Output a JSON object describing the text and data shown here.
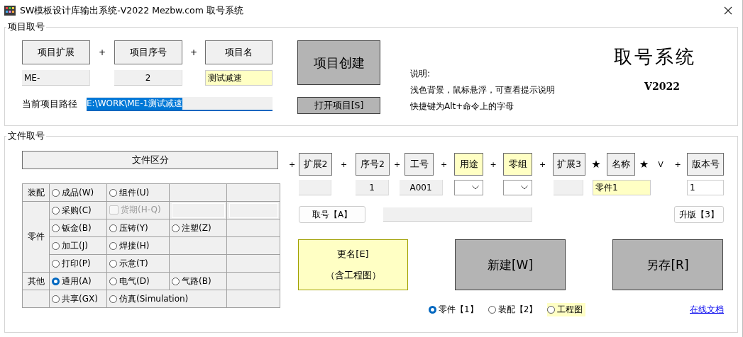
{
  "window": {
    "title": "SW模板设计库输出系统-V2022 Mezbw.com 取号系统"
  },
  "project": {
    "legend": "项目取号",
    "parts": [
      {
        "label": "项目扩展",
        "kind": "readonly",
        "value": "ME-",
        "highlight": false
      },
      {
        "label": "项目序号",
        "kind": "readonly",
        "value": "2",
        "highlight": false
      },
      {
        "label": "项目名",
        "kind": "input",
        "value": "测试减速",
        "highlight": true
      }
    ],
    "joiners": [
      "+",
      "+"
    ],
    "path_label": "当前项目路径",
    "path": {
      "value": "E:\\WORK\\ME-1测试减速",
      "text_selected": true
    },
    "create_button": "项目创建",
    "open_button": "打开项目[S]",
    "notes": [
      "说明:",
      "浅色背景，鼠标悬浮，可查看提示说明",
      "快捷键为Alt+命令上的字母"
    ],
    "app_title": "取号系统",
    "version": "V2022"
  },
  "file": {
    "legend": "文件取号",
    "category_button": "文件区分",
    "groups": [
      {
        "label": "装配",
        "rows": [
          [
            {
              "kind": "radio",
              "label": "成品(W)",
              "selected": false
            },
            {
              "kind": "radio",
              "label": "组件(U)",
              "selected": false
            },
            {
              "kind": "empty"
            },
            {
              "kind": "empty"
            }
          ]
        ]
      },
      {
        "label": "零件",
        "rows": [
          [
            {
              "kind": "radio",
              "label": "采购(C)",
              "selected": false
            },
            {
              "kind": "checkbox",
              "label": "货期(H-Q)",
              "checked": false,
              "disabled": true
            },
            {
              "kind": "field",
              "disabled": true
            },
            {
              "kind": "field",
              "disabled": true
            }
          ],
          [
            {
              "kind": "radio",
              "label": "钣金(B)",
              "selected": false
            },
            {
              "kind": "radio",
              "label": "压铸(Y)",
              "selected": false
            },
            {
              "kind": "radio",
              "label": "注塑(Z)",
              "selected": false
            },
            {
              "kind": "empty"
            }
          ],
          [
            {
              "kind": "radio",
              "label": "加工(J)",
              "selected": false
            },
            {
              "kind": "radio",
              "label": "焊接(H)",
              "selected": false
            },
            {
              "kind": "empty"
            },
            {
              "kind": "empty"
            }
          ],
          [
            {
              "kind": "radio",
              "label": "打印(P)",
              "selected": false
            },
            {
              "kind": "radio",
              "label": "示意(T)",
              "selected": false
            },
            {
              "kind": "empty"
            },
            {
              "kind": "empty"
            }
          ]
        ]
      },
      {
        "label": "其他",
        "rows": [
          [
            {
              "kind": "radio",
              "label": "通用(A)",
              "selected": true
            },
            {
              "kind": "radio",
              "label": "电气(D)",
              "selected": false
            },
            {
              "kind": "radio",
              "label": "气路(B)",
              "selected": false
            },
            {
              "kind": "empty"
            }
          ]
        ]
      },
      {
        "rows": [
          [
            {
              "kind": "radio",
              "label": "共享(GX)",
              "selected": false
            },
            {
              "kind": "radio",
              "label": "仿真(Simulation)",
              "selected": false
            },
            {
              "kind": "empty"
            }
          ]
        ]
      }
    ],
    "header": [
      {
        "kind": "sep",
        "text": "+"
      },
      {
        "kind": "button",
        "label": "扩展2",
        "highlight": false
      },
      {
        "kind": "sep",
        "text": "+"
      },
      {
        "kind": "button",
        "label": "序号2",
        "highlight": false
      },
      {
        "kind": "sep",
        "text": "+"
      },
      {
        "kind": "button",
        "label": "工号",
        "highlight": false
      },
      {
        "kind": "sep",
        "text": "+"
      },
      {
        "kind": "button",
        "label": "用途",
        "highlight": true
      },
      {
        "kind": "sep",
        "text": "+"
      },
      {
        "kind": "button",
        "label": "零组",
        "highlight": true
      },
      {
        "kind": "sep",
        "text": "+"
      },
      {
        "kind": "button",
        "label": "扩展3",
        "highlight": false
      },
      {
        "kind": "star",
        "text": "★"
      },
      {
        "kind": "button",
        "label": "名称",
        "highlight": false
      },
      {
        "kind": "star",
        "text": "★"
      },
      {
        "kind": "sep",
        "text": "V"
      },
      {
        "kind": "sep",
        "text": "+"
      },
      {
        "kind": "button",
        "label": "版本号",
        "highlight": false
      }
    ],
    "fields": [
      {
        "kind": "readonly"
      },
      {
        "kind": "readonly",
        "value": "1"
      },
      {
        "kind": "readonly",
        "value": "A001"
      },
      {
        "kind": "dropdown"
      },
      {
        "kind": "dropdown"
      },
      {
        "kind": "readonly"
      },
      {
        "kind": "input",
        "value": "零件1",
        "highlight": true
      },
      {
        "kind": "input",
        "value": "1",
        "highlight": false
      }
    ],
    "fetch_button": "取号【A】",
    "number_field": {
      "kind": "readonly"
    },
    "upgrade_button": "升版【3】",
    "actions": [
      {
        "kind": "highlight",
        "label": "更名[E]",
        "sublabel": "（含工程图）"
      },
      {
        "kind": "dark",
        "label": "新建[W]"
      },
      {
        "kind": "dark",
        "label": "另存[R]"
      }
    ],
    "doc_types": [
      {
        "label": "零件【1】",
        "selected": true,
        "highlight": false
      },
      {
        "label": "装配【2】",
        "selected": false,
        "highlight": false
      },
      {
        "label": "工程图",
        "selected": false,
        "highlight": true
      }
    ],
    "doc_link": "在线文档"
  }
}
